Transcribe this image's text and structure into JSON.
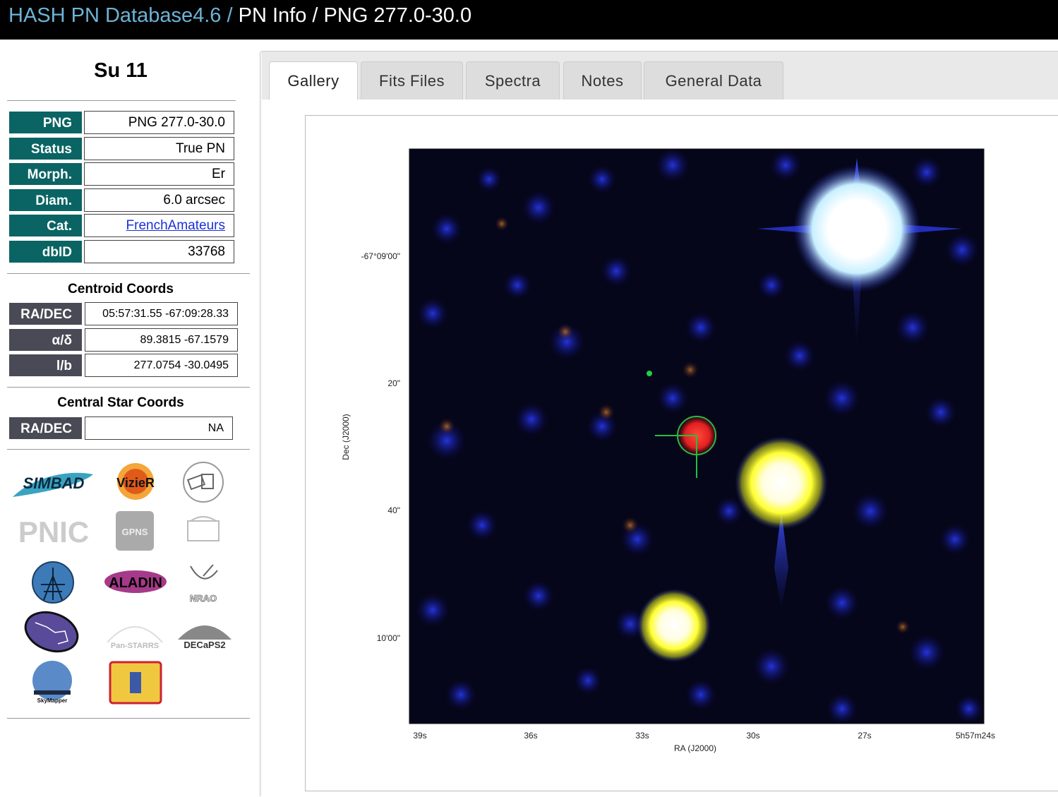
{
  "breadcrumb": {
    "root": "HASH PN Database4.6",
    "sep": "/",
    "section": "PN Info",
    "current": "PNG 277.0-30.0"
  },
  "object": {
    "name": "Su 11",
    "fields": [
      {
        "label": "PNG",
        "value": "PNG 277.0-30.0"
      },
      {
        "label": "Status",
        "value": "True PN"
      },
      {
        "label": "Morph.",
        "value": "Er"
      },
      {
        "label": "Diam.",
        "value": "6.0 arcsec"
      },
      {
        "label": "Cat.",
        "value": "FrenchAmateurs"
      },
      {
        "label": "dbID",
        "value": "33768"
      }
    ]
  },
  "centroid": {
    "title": "Centroid Coords",
    "rows": [
      {
        "label": "RA/DEC",
        "value": "05:57:31.55 -67:09:28.33"
      },
      {
        "label": "α/δ",
        "value": "89.3815 -67.1579"
      },
      {
        "label": "l/b",
        "value": "277.0754 -30.0495"
      }
    ]
  },
  "central_star": {
    "title": "Central Star Coords",
    "rows": [
      {
        "label": "RA/DEC",
        "value": "NA"
      }
    ]
  },
  "logos": [
    {
      "text": "SIMBAD"
    },
    {
      "text": "VizieR"
    },
    {
      "text": ""
    },
    {
      "text": "PNIC"
    },
    {
      "text": "GPNS"
    },
    {
      "text": ""
    },
    {
      "text": ""
    },
    {
      "text": "ALADIN"
    },
    {
      "text": "NRAO"
    },
    {
      "text": ""
    },
    {
      "text": "Pan-STARRS"
    },
    {
      "text": "DECaPS2"
    },
    {
      "text": "SkyMapper"
    },
    {
      "text": ""
    }
  ],
  "tabs": [
    "Gallery",
    "Fits Files",
    "Spectra",
    "Notes",
    "General Data"
  ],
  "active_tab": "Gallery",
  "figure": {
    "xlabel": "RA (J2000)",
    "ylabel": "Dec (J2000)",
    "xticks": [
      "39s",
      "36s",
      "33s",
      "30s",
      "27s",
      "5h57m24s"
    ],
    "yticks": [
      "-67°09'00\"",
      "20\"",
      "40\"",
      "10'00\""
    ]
  },
  "colors": {
    "teal": "#0a6464",
    "slate": "#4a4a56",
    "link": "#1a30d8",
    "crumb": "#6db3d6"
  }
}
